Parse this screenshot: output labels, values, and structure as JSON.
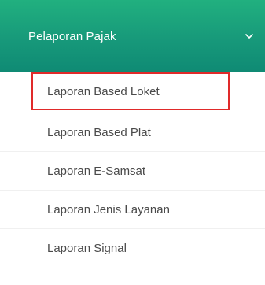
{
  "menu": {
    "header": {
      "label": "Pelaporan Pajak",
      "icon": "chevron-down-icon"
    },
    "items": [
      {
        "label": "Laporan Based Loket",
        "highlighted": true
      },
      {
        "label": "Laporan Based Plat"
      },
      {
        "label": "Laporan E-Samsat"
      },
      {
        "label": "Laporan Jenis Layanan"
      },
      {
        "label": "Laporan Signal"
      }
    ]
  },
  "colors": {
    "header_gradient_top": "#21b07f",
    "header_gradient_bottom": "#0f8a74",
    "highlight_border": "#e02a2a",
    "item_text": "#4a4a4a"
  }
}
